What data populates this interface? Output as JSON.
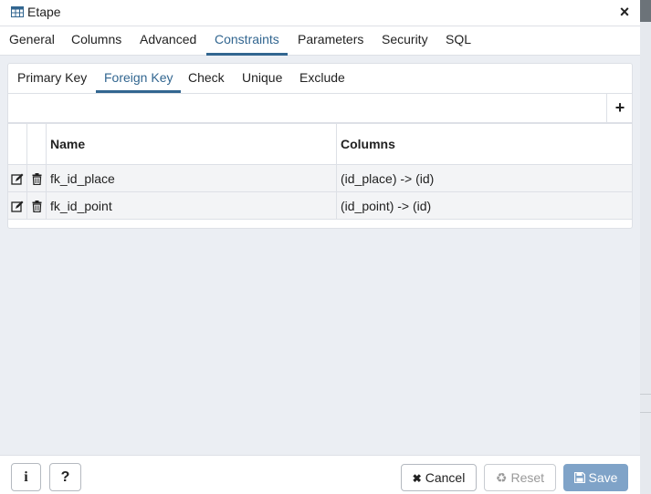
{
  "dialog": {
    "title": "Etape",
    "close_symbol": "×"
  },
  "tabs": [
    {
      "label": "General"
    },
    {
      "label": "Columns"
    },
    {
      "label": "Advanced"
    },
    {
      "label": "Constraints",
      "active": true
    },
    {
      "label": "Parameters"
    },
    {
      "label": "Security"
    },
    {
      "label": "SQL"
    }
  ],
  "subtabs": [
    {
      "label": "Primary Key"
    },
    {
      "label": "Foreign Key",
      "active": true
    },
    {
      "label": "Check"
    },
    {
      "label": "Unique"
    },
    {
      "label": "Exclude"
    }
  ],
  "grid": {
    "add_symbol": "+",
    "columns": [
      "Name",
      "Columns"
    ],
    "rows": [
      {
        "name": "fk_id_place",
        "columns": "(id_place) -> (id)"
      },
      {
        "name": "fk_id_point",
        "columns": "(id_point) -> (id)"
      }
    ]
  },
  "footer": {
    "info_symbol": "i",
    "help_symbol": "?",
    "cancel_label": "Cancel",
    "cancel_icon": "✖",
    "reset_label": "Reset",
    "reset_icon": "♻",
    "save_label": "Save",
    "save_icon": "💾"
  },
  "colors": {
    "accent": "#326690",
    "save_bg": "#7fa3c8",
    "background": "#ebeef3"
  },
  "icons": {
    "title": "table-icon",
    "edit": "edit-icon",
    "delete": "trash-icon"
  }
}
